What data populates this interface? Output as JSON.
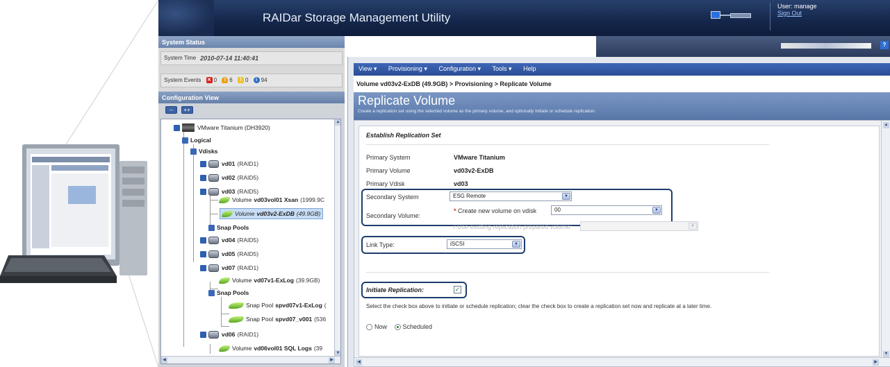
{
  "app": {
    "title": "RAIDar Storage Management Utility"
  },
  "user": {
    "label": "User: manage",
    "signout": "Sign Out"
  },
  "system_status": {
    "header": "System Status",
    "time_label": "System Time",
    "time_value": "2010-07-14 11:40:41",
    "events_label": "System Events",
    "events": {
      "critical": "0",
      "error": "6",
      "warning": "0",
      "info": "94"
    }
  },
  "config_view": {
    "header": "Configuration View",
    "collapse_label": "--",
    "expand_label": "++",
    "tree": {
      "system": "VMware Titanium (DH3920)",
      "logical": "Logical",
      "vdisks": "Vdisks",
      "vd01_name": "vd01",
      "vd01_raid": "(RAID1)",
      "vd02_name": "vd02",
      "vd02_raid": "(RAID5)",
      "vd03_name": "vd03",
      "vd03_raid": "(RAID5)",
      "vol1_prefix": "Volume",
      "vol1_name": "vd03vol01 Xsan",
      "vol1_size": "(1999.9C",
      "vol2_prefix": "Volume",
      "vol2_name": "vd03v2-ExDB",
      "vol2_size": "(49.9GB)",
      "snap_pools_1": "Snap Pools",
      "vd04_name": "vd04",
      "vd04_raid": "(RAID5)",
      "vd05_name": "vd05",
      "vd05_raid": "(RAID5)",
      "vd07_name": "vd07",
      "vd07_raid": "(RAID1)",
      "vol3_prefix": "Volume",
      "vol3_name": "vd07v1-ExLog",
      "vol3_size": "(39.9GB)",
      "snap_pools_2": "Snap Pools",
      "sp1_prefix": "Snap Pool",
      "sp1_name": "spvd07v1-ExLog",
      "sp1_size": "(",
      "sp2_prefix": "Snap Pool",
      "sp2_name": "spvd07_v001",
      "sp2_size": "(536",
      "vd06_name": "vd06",
      "vd06_raid": "(RAID1)",
      "vol4_prefix": "Volume",
      "vol4_name": "vd06vol01 SQL Logs",
      "vol4_size": "(39"
    }
  },
  "menu": {
    "view": "View ▾",
    "provisioning": "Provisioning ▾",
    "configuration": "Configuration ▾",
    "tools": "Tools ▾",
    "help": "Help"
  },
  "breadcrumb": "Volume vd03v2-ExDB (49.9GB) > Provisioning > Replicate Volume",
  "page": {
    "title": "Replicate Volume",
    "subtitle": "Create a replication set using the selected volume as the primary volume, and optionally initiate or schedule replication."
  },
  "form": {
    "section_title": "Establish Replication Set",
    "primary_system_label": "Primary System",
    "primary_system_value": "VMware Titanium",
    "primary_volume_label": "Primary Volume",
    "primary_volume_value": "vd03v2-ExDB",
    "primary_vdisk_label": "Primary Vdisk",
    "primary_vdisk_value": "vd03",
    "secondary_system_label": "Secondary System",
    "secondary_system_value": "ESG Remote",
    "secondary_volume_label": "Secondary Volume:",
    "create_new_label": "Create new volume on vdisk",
    "create_new_value": "00",
    "use_existing_label": "Use existing replication prepared volume:",
    "link_type_label": "Link Type:",
    "link_type_value": "iSCSI",
    "initiate_label": "Initiate Replication:",
    "initiate_help": "Select the check box above to initiate or schedule replication; clear the check box to create a replication set now and replicate at a later time.",
    "now_label": "Now",
    "scheduled_label": "Scheduled"
  },
  "colors": {
    "banner": "#14264a",
    "menubar": "#2a4d94",
    "highlight": "#1c3c6b",
    "page_head": "#5776a8"
  }
}
